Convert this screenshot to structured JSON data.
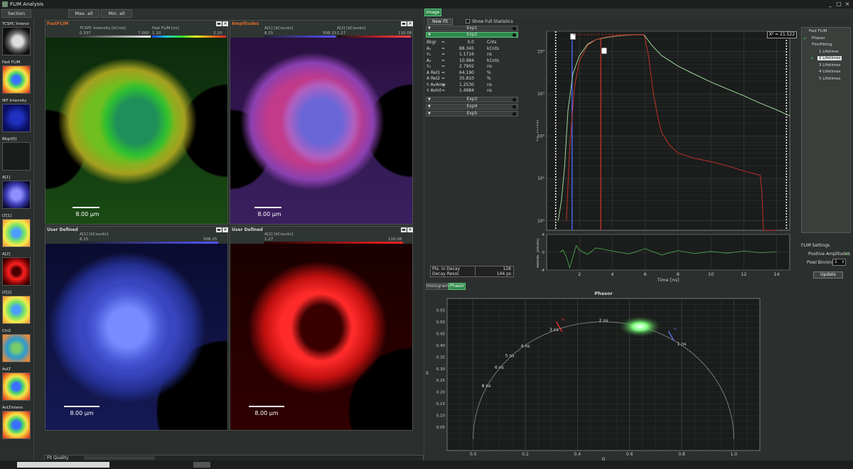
{
  "window": {
    "title": "FLIM Analysis",
    "controls": [
      "_",
      "□",
      "×"
    ]
  },
  "toolbar": {
    "section_label": "Section",
    "max_all_label": "Max. all",
    "min_all_label": "Min. all"
  },
  "thumbnails": [
    {
      "label": "TCSPC Intensi",
      "style": "gray"
    },
    {
      "label": "Fast FLIM",
      "style": "rainbow"
    },
    {
      "label": "IRF Intensity",
      "style": "blue"
    },
    {
      "label": "Bkgr[0]",
      "style": "dark"
    },
    {
      "label": "A[1]",
      "style": "purple"
    },
    {
      "label": "LT[1]",
      "style": "rainbow2"
    },
    {
      "label": "A[2]",
      "style": "red"
    },
    {
      "label": "LT[2]",
      "style": "rainbow2"
    },
    {
      "label": "Chi2",
      "style": "cyan"
    },
    {
      "label": "AvLT",
      "style": "rainbow"
    },
    {
      "label": "AvLTintens",
      "style": "rainbow"
    }
  ],
  "panels": [
    {
      "title": "FastFLIM",
      "title_color": "#e06a2a",
      "cb1_title": "TCSPC Intensity [kCnts]",
      "cb1_min": "0.337",
      "cb1_max": "7.000",
      "cb2_title": "Fast FLIM [ns]",
      "cb2_min": "1.10",
      "cb2_max": "2.10",
      "scale": "8.00 µm",
      "image": "green"
    },
    {
      "title": "Amplitudes",
      "title_color": "#e06a2a",
      "cb1_title": "A[1] [kCounts]",
      "cb1_min": "8.15",
      "cb1_max": "508.15",
      "cb2_title": "A[2] [kCounts]",
      "cb2_min": "1.27",
      "cb2_max": "110.08",
      "scale": "8.00 µm",
      "image": "magenta"
    },
    {
      "title": "User Defined",
      "title_color": "#d8d8d8",
      "cb1_title": "A[1] [kCounts]",
      "cb1_min": "8.15",
      "cb1_max": "508.15",
      "cb2_title": "",
      "cb2_min": "",
      "cb2_max": "",
      "scale": "8.00 µm",
      "image": "blue"
    },
    {
      "title": "User Defined",
      "title_color": "#d8d8d8",
      "cb1_title": "A[2] [kCounts]",
      "cb1_min": "1.27",
      "cb1_max": "110.08",
      "cb2_title": "",
      "cb2_min": "",
      "cb2_max": "",
      "scale": "8.00 µm",
      "image": "red"
    }
  ],
  "fit_quality_label": "Fit Quality",
  "right": {
    "image_tab": "Image",
    "new_fit_label": "New Fit",
    "show_full_stats_label": "Show Full Statistics",
    "groups": [
      "Exp1",
      "Exp2",
      "Exp3",
      "Exp4",
      "Exp5"
    ],
    "params": [
      {
        "name": "Bkgr",
        "value": "0.0",
        "unit": "Cnts"
      },
      {
        "name": "A₁",
        "value": "88.345",
        "unit": "kCnts"
      },
      {
        "name": "τ₁",
        "value": "1.1716",
        "unit": "ns"
      },
      {
        "name": "A₂",
        "value": "10.984",
        "unit": "kCnts"
      },
      {
        "name": "τ₂",
        "value": "2.7902",
        "unit": "ns"
      },
      {
        "name": "A Rel1",
        "value": "64.190",
        "unit": "%"
      },
      {
        "name": "A Rel2",
        "value": "35.810",
        "unit": "%"
      },
      {
        "name": "τ AvAmp",
        "value": "1.2530",
        "unit": "ns"
      },
      {
        "name": "τ AvInt",
        "value": "1.4984",
        "unit": "ns"
      }
    ],
    "pts_in_decay_label": "Pts. in Decay",
    "pts_in_decay_value": "128",
    "decay_resol_label": "Decay Resol.",
    "decay_resol_value": "144 ps",
    "chi2": "X² = 21.522",
    "histogram_tab": "Histogram",
    "phasor_tab": "Phasor",
    "phasor_title": "Phasor"
  },
  "settings": {
    "tree": [
      "Fast FLIM",
      "Phasor",
      "FlimFitting",
      "1 Lifetime",
      "2 Lifetimes",
      "3 Lifetimes",
      "4 Lifetimes",
      "5 Lifetimes"
    ],
    "selected": "2 Lifetimes",
    "flim_settings_label": "FLIM Settings",
    "positive_amplitudes_label": "Positive Amplitudes",
    "pixel_binning_label": "Pixel Binning",
    "pixel_binning_value": "1",
    "update_label": "Update"
  },
  "colors": {
    "accent": "#2e8a4a",
    "orange": "#e06a2a",
    "data_green": "#9fd49a",
    "fit_red": "#c0302a",
    "irf_blue": "#4a66ff"
  },
  "chart_data": [
    {
      "type": "line",
      "xlabel": "Time [ns]",
      "ylabel": "Int. [Cnts]",
      "yscale": "log",
      "xlim": [
        0,
        14.8
      ],
      "ylim": [
        0.6,
        30000
      ],
      "xticks": [
        2,
        4,
        6,
        8,
        10,
        12,
        14
      ],
      "yticks": [
        "10⁰",
        "10¹",
        "10²",
        "10³",
        "10⁴"
      ],
      "series": [
        {
          "color": "#9fd49a",
          "x": [
            0.7,
            0.9,
            1.1,
            1.3,
            1.6,
            2.0,
            2.5,
            3.0,
            3.5,
            4.0,
            4.5,
            5.0,
            5.5,
            5.9,
            6.0,
            6.4,
            7.0,
            8.0,
            9.0,
            10.0,
            11.0,
            12.0,
            13.0,
            14.0,
            14.8
          ],
          "y": [
            1,
            3,
            20,
            400,
            3000,
            8000,
            15000,
            19000,
            21000,
            22500,
            23500,
            24500,
            25000,
            25000,
            23000,
            14000,
            8000,
            4500,
            2900,
            1900,
            1300,
            900,
            600,
            420,
            300
          ]
        },
        {
          "color": "#c0302a",
          "x": [
            1.2,
            1.4,
            1.7,
            2.0,
            2.5,
            3.0,
            3.5,
            4.0,
            4.5,
            5.0,
            5.5,
            5.9,
            6.0,
            6.2,
            6.5,
            6.8,
            7.0,
            7.5,
            8.0,
            9.0,
            10.0,
            11.0,
            12.0,
            13.0,
            13.1,
            13.2,
            14.0
          ],
          "y": [
            1,
            50,
            1500,
            6000,
            14000,
            19000,
            21500,
            23000,
            24000,
            24800,
            25000,
            25000,
            20000,
            8000,
            1000,
            250,
            120,
            60,
            40,
            30,
            25,
            20,
            15,
            12,
            5,
            0.6,
            0.6
          ]
        }
      ],
      "markers": [
        {
          "x": 1.55,
          "color": "#4a66ff"
        },
        {
          "x": 3.3,
          "color": "#c0302a"
        }
      ]
    },
    {
      "type": "line",
      "ylabel": "Resids. [stDev]",
      "xlim": [
        0,
        14.8
      ],
      "ylim": [
        -4,
        4
      ],
      "xticks": [
        2,
        4,
        6,
        8,
        10,
        12,
        14
      ],
      "yticks": [
        "4",
        "0",
        "-4"
      ],
      "series": [
        {
          "color": "#4caf50",
          "x": [
            0.8,
            1.0,
            1.2,
            1.4,
            1.6,
            1.8,
            2.0,
            2.5,
            3,
            4,
            5,
            6,
            7,
            8,
            9,
            10,
            11,
            12,
            13,
            14
          ],
          "y": [
            0,
            0.5,
            -1,
            -3.5,
            -1,
            1.5,
            0.5,
            -0.5,
            1,
            0.3,
            -0.4,
            0.8,
            -0.6,
            0.4,
            -0.3,
            0.2,
            -0.2,
            0.3,
            -0.1,
            0.1
          ]
        }
      ]
    },
    {
      "type": "scatter",
      "title": "Phasor",
      "xlabel": "G",
      "ylabel": "S",
      "xlim": [
        -0.1,
        1.1
      ],
      "ylim": [
        -0.05,
        0.6
      ],
      "xticks": [
        "0.0",
        "0.2",
        "0.4",
        "0.6",
        "0.8",
        "1.0"
      ],
      "yticks": [
        "0.05",
        "0.10",
        "0.15",
        "0.20",
        "0.25",
        "0.30",
        "0.35",
        "0.40",
        "0.45",
        "0.50",
        "0.55"
      ],
      "semicircle_labels": [
        {
          "text": "1 ns",
          "g": 0.8,
          "s": 0.4
        },
        {
          "text": "2 ns",
          "g": 0.5,
          "s": 0.5
        },
        {
          "text": "3 ns",
          "g": 0.31,
          "s": 0.46
        },
        {
          "text": "4 ns",
          "g": 0.2,
          "s": 0.39
        },
        {
          "text": "5 ns",
          "g": 0.14,
          "s": 0.35
        },
        {
          "text": "6 ns",
          "g": 0.1,
          "s": 0.3
        },
        {
          "text": "8 ns",
          "g": 0.05,
          "s": 0.22
        }
      ],
      "cluster": {
        "g": 0.64,
        "s": 0.48,
        "color": "#7fff7f"
      },
      "tau_markers": [
        {
          "label": "τ₂",
          "g": 0.33,
          "s": 0.47,
          "color": "#ff3030"
        },
        {
          "label": "τ₁",
          "g": 0.76,
          "s": 0.43,
          "color": "#5a7aff"
        }
      ]
    }
  ]
}
